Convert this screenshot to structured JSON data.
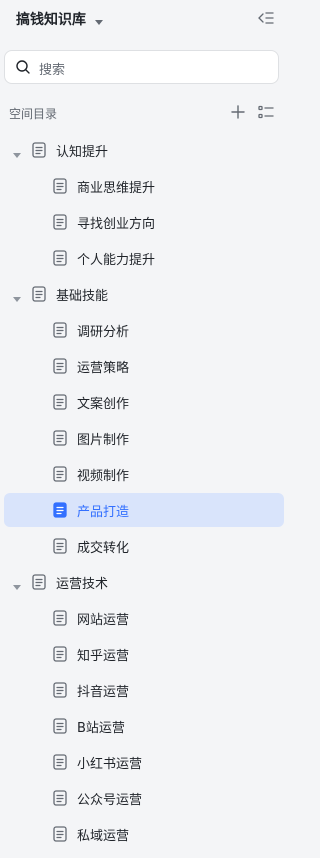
{
  "header": {
    "title": "搞钱知识库"
  },
  "search": {
    "placeholder": "搜索"
  },
  "section": {
    "label": "空间目录"
  },
  "tree": [
    {
      "label": "认知提升",
      "children": [
        {
          "label": "商业思维提升"
        },
        {
          "label": "寻找创业方向"
        },
        {
          "label": "个人能力提升"
        }
      ]
    },
    {
      "label": "基础技能",
      "children": [
        {
          "label": "调研分析"
        },
        {
          "label": "运营策略"
        },
        {
          "label": "文案创作"
        },
        {
          "label": "图片制作"
        },
        {
          "label": "视频制作"
        },
        {
          "label": "产品打造",
          "active": true
        },
        {
          "label": "成交转化"
        }
      ]
    },
    {
      "label": "运营技术",
      "children": [
        {
          "label": "网站运营"
        },
        {
          "label": "知乎运营"
        },
        {
          "label": "抖音运营"
        },
        {
          "label": "B站运营"
        },
        {
          "label": "小红书运营"
        },
        {
          "label": "公众号运营"
        },
        {
          "label": "私域运营"
        }
      ]
    }
  ],
  "colors": {
    "accent": "#3370ff",
    "active_bg": "#d9e4fb",
    "bg": "#f4f5f7"
  },
  "icons": {
    "dropdown": "chevron-down-icon",
    "collapse": "collapse-sidebar-icon",
    "search": "search-icon",
    "add": "plus-icon",
    "list": "list-icon",
    "expand": "caret-down-icon",
    "doc": "document-icon"
  }
}
